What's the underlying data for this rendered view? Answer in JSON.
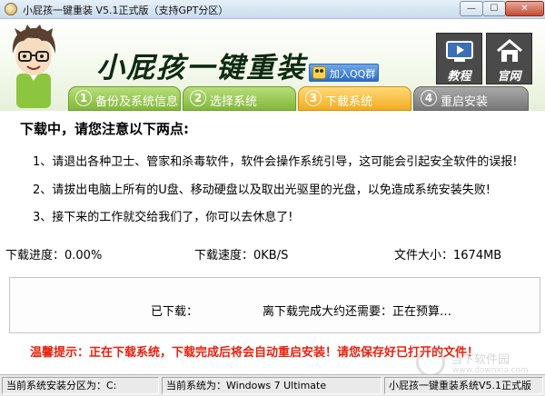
{
  "window": {
    "title": "小屁孩一键重装 V5.1正式版（支持GPT分区）",
    "close_glyph": "✕",
    "min_glyph": "—",
    "max_glyph": "☐"
  },
  "header": {
    "brand": "小屁孩一键重装",
    "qq_label": "加入QQ群",
    "tutorial_label": "教程",
    "home_label": "官网"
  },
  "steps": [
    {
      "num": "1",
      "label": "备份及系统信息",
      "state": "done"
    },
    {
      "num": "2",
      "label": "选择系统",
      "state": "done"
    },
    {
      "num": "3",
      "label": "下载系统",
      "state": "active"
    },
    {
      "num": "4",
      "label": "重启安装",
      "state": "pending"
    }
  ],
  "main": {
    "notice_title": "下载中，请您注意以下两点:",
    "notices": [
      "1、请退出各种卫士、管家和杀毒软件，软件会操作系统引导，这可能会引起安全软件的误报!",
      "2、请拔出电脑上所有的U盘、移动硬盘以及取出光驱里的光盘，以免造成系统安装失败!",
      "3、接下来的工作就交给我们了，你可以去休息了!"
    ],
    "progress_text": "下载进度：0.00%",
    "speed_text": "下载速度：0KB/S",
    "size_text": "文件大小：1674MB",
    "progress_value": 0,
    "downloaded_label": "已下载：",
    "remaining_text": "离下载完成大约还需要：正在预算…",
    "tip": "温馨提示：正在下载系统，下载完成后将会自动重启安装！请您保存好已打开的文件！"
  },
  "statusbar": {
    "partition": "当前系统安装分区为：C:",
    "current_os": "当前系统为：Windows 7 Ultimate",
    "version": "小屁孩一键重装系统V5.1正式版"
  },
  "watermark": {
    "text1": "当下软件园",
    "text2": "www.downxia.com"
  },
  "icons": {
    "app": "app-icon",
    "qq": "qq-icon",
    "tutorial": "video-play-icon",
    "home": "house-icon"
  },
  "colors": {
    "step_done": "#82b83a",
    "step_active": "#f2ac21",
    "step_pending": "#777777",
    "tip_red": "#e8200e"
  }
}
